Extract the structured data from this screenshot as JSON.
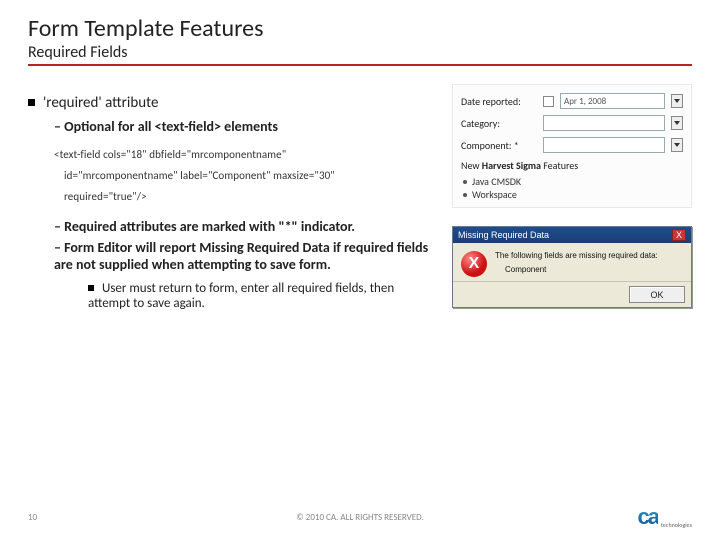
{
  "title": "Form Template Features",
  "subtitle": "Required Fields",
  "bullet1": "'required' attribute",
  "sub1": "Optional for all <text-field> elements",
  "code_l1": "<text-field cols=\"18\" dbfield=\"mrcomponentname\"",
  "code_l2": "id=\"mrcomponentname\" label=\"Component\" maxsize=\"30\"",
  "code_l3": "required=\"true\"/>",
  "sub2": "Required attributes are marked with \"*\" indicator.",
  "sub3": "Form Editor will report Missing Required Data if required fields are not supplied when attempting to save form.",
  "sub4": "User must return to form, enter all required fields, then attempt to save again.",
  "mock": {
    "row1_label": "Date reported:",
    "row1_value": "Apr 1, 2008",
    "row2_label": "Category:",
    "row3_label": "Component: *",
    "section_prefix": "New ",
    "section_bold": "Harvest Sigma",
    "section_suffix": " Features",
    "li1": "Java CMSDK",
    "li2": "Workspace"
  },
  "dialog": {
    "title": "Missing Required Data",
    "x": "X",
    "icon": "X",
    "msg1": "The following fields are missing required data:",
    "msg2": "Component",
    "ok": "OK"
  },
  "footer": {
    "page": "10",
    "copyright": "© 2010 CA. ALL RIGHTS RESERVED.",
    "logo": "ca",
    "logo_sub": "technologies"
  }
}
